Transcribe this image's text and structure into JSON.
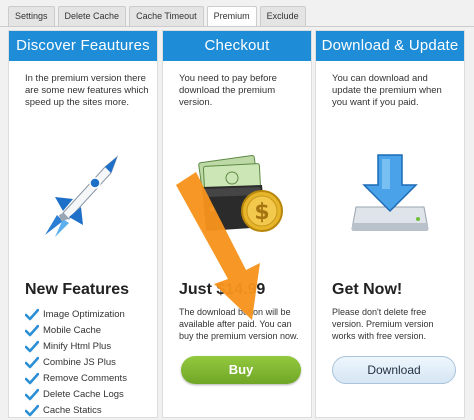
{
  "tabs": [
    {
      "label": "Settings",
      "active": false
    },
    {
      "label": "Delete Cache",
      "active": false
    },
    {
      "label": "Cache Timeout",
      "active": false
    },
    {
      "label": "Premium",
      "active": true
    },
    {
      "label": "Exclude",
      "active": false
    }
  ],
  "panels": {
    "discover": {
      "header": "Discover Feautures",
      "description": "In the premium version there are some new features which speed up the sites more.",
      "icon": "rocket-icon",
      "subtitle": "New Features",
      "features": [
        "Image Optimization",
        "Mobile Cache",
        "Minify Html Plus",
        "Combine JS Plus",
        "Remove Comments",
        "Delete Cache Logs",
        "Cache Statics"
      ]
    },
    "checkout": {
      "header": "Checkout",
      "description": "You need to pay before download the premium version.",
      "icon": "wallet-money-icon",
      "price_title": "Just $14.99",
      "price_text": "The download button will be available after paid. You can buy the premium version now.",
      "buy_label": "Buy"
    },
    "download": {
      "header": "Download & Update",
      "description": "You can download and update the premium when you want if you paid.",
      "icon": "download-drive-icon",
      "subtitle": "Get Now!",
      "note": "Please don't delete free version. Premium version works with free version.",
      "download_label": "Download"
    }
  },
  "colors": {
    "header_blue": "#1e8cd7",
    "buy_green": "#7ab430",
    "check_blue": "#2b8fd6",
    "arrow_orange": "#f7941d"
  }
}
